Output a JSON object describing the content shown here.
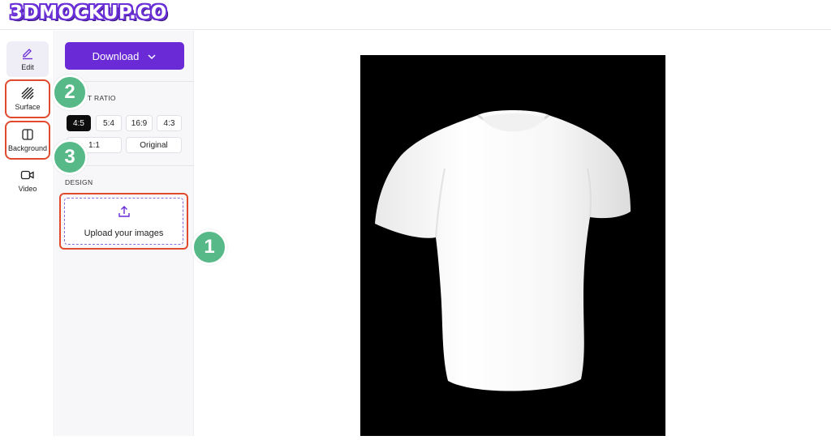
{
  "header": {
    "logo_text": "3DMOCKUP.CO"
  },
  "rail": {
    "items": [
      {
        "label": "Edit",
        "icon": "pen-icon"
      },
      {
        "label": "Surface",
        "icon": "hatch-icon"
      },
      {
        "label": "Background",
        "icon": "split-rect-icon"
      },
      {
        "label": "Video",
        "icon": "video-icon"
      }
    ]
  },
  "panel": {
    "download_label": "Download",
    "aspect_ratio_label": "T RATIO",
    "ratios": [
      "4:5",
      "5:4",
      "16:9",
      "4:3",
      "1:1",
      "Original"
    ],
    "selected_ratio": "4:5",
    "design_label": "DESIGN",
    "upload_label": "Upload your images"
  },
  "badges": {
    "one": "1",
    "two": "2",
    "three": "3"
  },
  "colors": {
    "accent": "#6a2ad6",
    "highlight": "#e14a2c",
    "badge": "#57b987",
    "canvas": "#000000"
  }
}
